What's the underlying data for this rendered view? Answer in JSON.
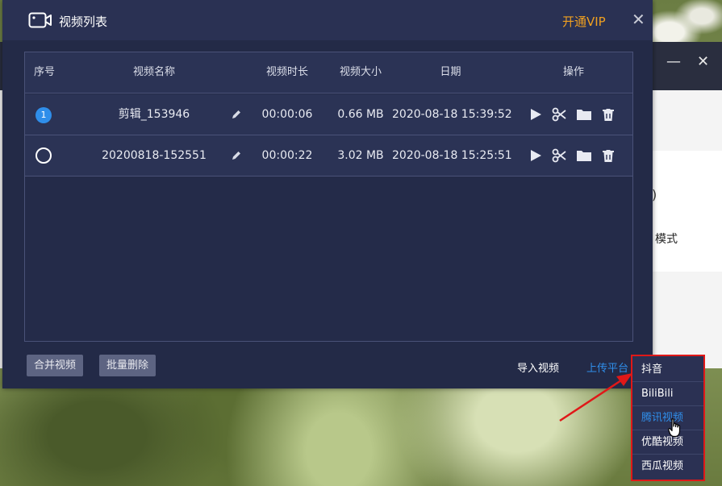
{
  "dialog": {
    "title": "视频列表",
    "vip_label": "开通VIP",
    "close_symbol": "✕"
  },
  "table": {
    "headers": {
      "index": "序号",
      "name": "视频名称",
      "duration": "视频时长",
      "size": "视频大小",
      "date": "日期",
      "ops": "操作"
    },
    "rows": [
      {
        "index": "1",
        "selected": true,
        "name": "剪辑_153946",
        "duration": "00:00:06",
        "size": "0.66 MB",
        "date": "2020-08-18 15:39:52"
      },
      {
        "index": "",
        "selected": false,
        "name": "20200818-152551",
        "duration": "00:00:22",
        "size": "3.02 MB",
        "date": "2020-08-18 15:25:51"
      }
    ],
    "row_icons": [
      "play-icon",
      "scissors-icon",
      "folder-icon",
      "trash-icon"
    ],
    "edit_icon": "pencil-icon"
  },
  "footer": {
    "merge_label": "合并视频",
    "batch_delete_label": "批量删除",
    "import_label": "导入视频",
    "upload_label": "上传平台"
  },
  "dropdown": {
    "items": [
      {
        "label": "抖音",
        "active": false
      },
      {
        "label": "BiliBili",
        "active": false
      },
      {
        "label": "腾讯视频",
        "active": true
      },
      {
        "label": "优酷视频",
        "active": false
      },
      {
        "label": "西瓜视频",
        "active": false
      }
    ]
  },
  "background_app": {
    "minimize_symbol": "—",
    "close_symbol": "✕",
    "partial_text": "模式",
    "partial_paren": ")"
  },
  "colors": {
    "accent": "#2f8eea",
    "vip": "#f0a020",
    "annotation": "#e01818",
    "dialog_bg": "#232a47"
  }
}
